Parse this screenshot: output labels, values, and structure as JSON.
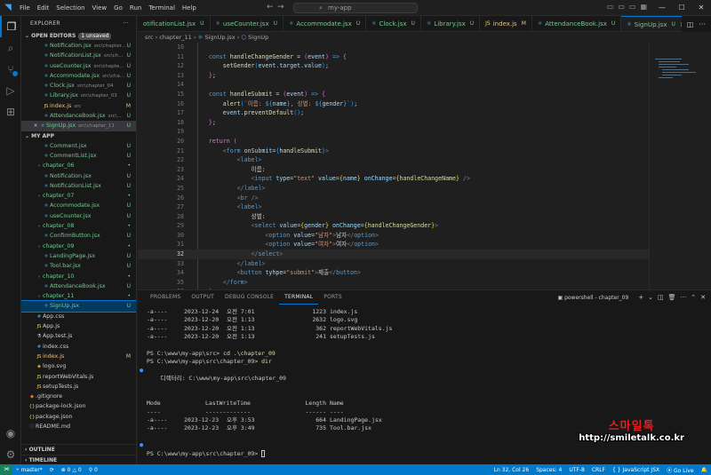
{
  "titlebar": {
    "menu": [
      "File",
      "Edit",
      "Selection",
      "View",
      "Go",
      "Run",
      "Terminal",
      "Help"
    ],
    "search": "my-app"
  },
  "sidebar": {
    "header": "EXPLORER",
    "open_editors": "OPEN EDITORS",
    "unsaved": "1 unsaved",
    "open_items": [
      {
        "name": "Notification.jsx",
        "path": "src\\chapter...",
        "status": "U",
        "icon": "react"
      },
      {
        "name": "NotificationList.jsx",
        "path": "src\\ch...",
        "status": "U",
        "icon": "react"
      },
      {
        "name": "useCounter.jsx",
        "path": "src\\chapte...",
        "status": "U",
        "icon": "react"
      },
      {
        "name": "Accommodate.jsx",
        "path": "src\\cha...",
        "status": "U",
        "icon": "react"
      },
      {
        "name": "Clock.jsx",
        "path": "src\\chapter_04",
        "status": "U",
        "icon": "react"
      },
      {
        "name": "Library.jsx",
        "path": "src\\chapter_03",
        "status": "U",
        "icon": "react"
      },
      {
        "name": "index.js",
        "path": "src",
        "status": "M",
        "icon": "js"
      },
      {
        "name": "AttendanceBook.jsx",
        "path": "src\\...",
        "status": "U",
        "icon": "react"
      },
      {
        "name": "SignUp.jsx",
        "path": "src\\chapter_11",
        "status": "U",
        "icon": "react"
      }
    ],
    "project": "MY APP",
    "tree": [
      {
        "name": "Comment.jsx",
        "status": "U",
        "icon": "react",
        "indent": 2,
        "kind": "file"
      },
      {
        "name": "CommentList.jsx",
        "status": "U",
        "icon": "react",
        "indent": 2,
        "kind": "file"
      },
      {
        "name": "chapter_06",
        "status": "•",
        "icon": "chev",
        "indent": 1,
        "kind": "folder"
      },
      {
        "name": "Notification.jsx",
        "status": "U",
        "icon": "react",
        "indent": 2,
        "kind": "file"
      },
      {
        "name": "NotificationList.jsx",
        "status": "U",
        "icon": "react",
        "indent": 2,
        "kind": "file"
      },
      {
        "name": "chapter_07",
        "status": "•",
        "icon": "chev",
        "indent": 1,
        "kind": "folder"
      },
      {
        "name": "Accommodate.jsx",
        "status": "U",
        "icon": "react",
        "indent": 2,
        "kind": "file"
      },
      {
        "name": "useCounter.jsx",
        "status": "U",
        "icon": "react",
        "indent": 2,
        "kind": "file"
      },
      {
        "name": "chapter_08",
        "status": "•",
        "icon": "chev",
        "indent": 1,
        "kind": "folder"
      },
      {
        "name": "ConfirmButton.jsx",
        "status": "U",
        "icon": "react",
        "indent": 2,
        "kind": "file"
      },
      {
        "name": "chapter_09",
        "status": "•",
        "icon": "chev",
        "indent": 1,
        "kind": "folder"
      },
      {
        "name": "LandingPage.jsx",
        "status": "U",
        "icon": "react",
        "indent": 2,
        "kind": "file"
      },
      {
        "name": "Tool.bar.jsx",
        "status": "U",
        "icon": "react",
        "indent": 2,
        "kind": "file"
      },
      {
        "name": "chapter_10",
        "status": "•",
        "icon": "chev",
        "indent": 1,
        "kind": "folder"
      },
      {
        "name": "AttendanceBook.jsx",
        "status": "U",
        "icon": "react",
        "indent": 2,
        "kind": "file"
      },
      {
        "name": "chapter_11",
        "status": "•",
        "icon": "chev",
        "indent": 1,
        "kind": "folder"
      },
      {
        "name": "SignUp.jsx",
        "status": "U",
        "icon": "react",
        "indent": 2,
        "kind": "file",
        "selected": true
      },
      {
        "name": "App.css",
        "status": "",
        "icon": "css",
        "indent": 1,
        "kind": "plain"
      },
      {
        "name": "App.js",
        "status": "",
        "icon": "js",
        "indent": 1,
        "kind": "plain"
      },
      {
        "name": "App.test.js",
        "status": "",
        "icon": "test",
        "indent": 1,
        "kind": "plain"
      },
      {
        "name": "index.css",
        "status": "",
        "icon": "css",
        "indent": 1,
        "kind": "plain"
      },
      {
        "name": "index.js",
        "status": "M",
        "icon": "js",
        "indent": 1,
        "kind": "mod"
      },
      {
        "name": "logo.svg",
        "status": "",
        "icon": "svg",
        "indent": 1,
        "kind": "plain"
      },
      {
        "name": "reportWebVitals.js",
        "status": "",
        "icon": "js",
        "indent": 1,
        "kind": "plain"
      },
      {
        "name": "setupTests.js",
        "status": "",
        "icon": "js",
        "indent": 1,
        "kind": "plain"
      },
      {
        "name": ".gitignore",
        "status": "",
        "icon": "git",
        "indent": 0,
        "kind": "plain"
      },
      {
        "name": "package-lock.json",
        "status": "",
        "icon": "json",
        "indent": 0,
        "kind": "plain"
      },
      {
        "name": "package.json",
        "status": "",
        "icon": "json",
        "indent": 0,
        "kind": "plain"
      },
      {
        "name": "README.md",
        "status": "",
        "icon": "info",
        "indent": 0,
        "kind": "plain"
      }
    ],
    "outline": "OUTLINE",
    "timeline": "TIMELINE"
  },
  "tabs": [
    {
      "name": "otificationList.jsx",
      "status": "U",
      "icon": "react"
    },
    {
      "name": "useCounter.jsx",
      "status": "U",
      "icon": "react"
    },
    {
      "name": "Accommodate.jsx",
      "status": "U",
      "icon": "react"
    },
    {
      "name": "Clock.jsx",
      "status": "U",
      "icon": "react"
    },
    {
      "name": "Library.jsx",
      "status": "U",
      "icon": "react"
    },
    {
      "name": "index.js",
      "status": "M",
      "icon": "js"
    },
    {
      "name": "AttendanceBook.jsx",
      "status": "U",
      "icon": "react"
    },
    {
      "name": "SignUp.jsx",
      "status": "U",
      "icon": "react",
      "active": true
    }
  ],
  "breadcrumb": {
    "p1": "src",
    "p2": "chapter_11",
    "p3": "SignUp.jsx",
    "p4": "SignUp"
  },
  "editor": {
    "line_numbers": [
      "10",
      "11",
      "12",
      "13",
      "14",
      "15",
      "16",
      "17",
      "18",
      "19",
      "20",
      "21",
      "22",
      "23",
      "24",
      "25",
      "26",
      "27",
      "28",
      "29",
      "30",
      "31",
      "32",
      "33",
      "34",
      "35",
      "36",
      "37"
    ],
    "current_line": "32"
  },
  "panel": {
    "tabs": [
      "PROBLEMS",
      "OUTPUT",
      "DEBUG CONSOLE",
      "TERMINAL",
      "PORTS"
    ],
    "shell": "powershell - chapter_09",
    "listing1": [
      {
        "mode": "-a----",
        "date": "2023-12-24",
        "time": "오전 7:01",
        "len": "1223",
        "name": "index.js"
      },
      {
        "mode": "-a----",
        "date": "2023-12-20",
        "time": "오전 1:13",
        "len": "2632",
        "name": "logo.svg"
      },
      {
        "mode": "-a----",
        "date": "2023-12-20",
        "time": "오전 1:13",
        "len": "362",
        "name": "reportWebVitals.js"
      },
      {
        "mode": "-a----",
        "date": "2023-12-20",
        "time": "오전 1:13",
        "len": "241",
        "name": "setupTests.js"
      }
    ],
    "prompt1": "PS C:\\www\\my-app\\src> ",
    "cmd1": "cd .\\chapter_09",
    "prompt2": "PS C:\\www\\my-app\\src\\chapter_09> ",
    "cmd2": "dir",
    "dirline": "    디렉터리: C:\\www\\my-app\\src\\chapter_09",
    "hdr": {
      "mode": "Mode",
      "lwt": "LastWriteTime",
      "len": "Length",
      "name": "Name"
    },
    "sep": {
      "mode": "----",
      "lwt": "-------------",
      "len": "------",
      "name": "----"
    },
    "listing2": [
      {
        "mode": "-a----",
        "date": "2023-12-23",
        "time": "오후 3:53",
        "len": "664",
        "name": "LandingPage.jsx"
      },
      {
        "mode": "-a----",
        "date": "2023-12-23",
        "time": "오후 3:49",
        "len": "735",
        "name": "Tool.bar.jsx"
      }
    ],
    "prompt3": "PS C:\\www\\my-app\\src\\chapter_09> "
  },
  "watermark": {
    "line1": "스마일톡",
    "line2": "http://smiletalk.co.kr"
  },
  "status": {
    "branch": "master*",
    "sync": "⟳",
    "errors": "⊗ 0 △ 0",
    "ports": "⚲ 0",
    "position": "Ln 32, Col 26",
    "spaces": "Spaces: 4",
    "encoding": "UTF-8",
    "eol": "CRLF",
    "language": "{ } JavaScript JSX",
    "golive": "⦿ Go Live"
  },
  "colors": {
    "accent": "#0078d4",
    "statusbar": "#007acc",
    "untracked": "#73c991",
    "modified": "#e2c08d"
  }
}
